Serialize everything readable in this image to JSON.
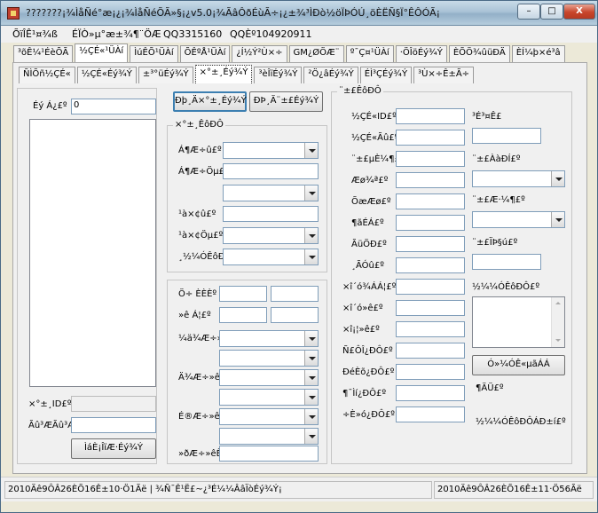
{
  "window": {
    "title": "???????¡¾ÌåÑé°æ¡¿¡¾ÌåÑéÕÃ»§¡¿v5.0¡¾ÃâÔðÉùÃ÷¡¿±¾³ÌÐò½öÏÞÓÚ¸öÈËÑ§Ï°ÊÔÓÃ¡",
    "minimize_label": "–",
    "maximize_label": "□",
    "close_label": "X"
  },
  "menu": {
    "items": [
      "ÕïÎÊ¹¤¾ß",
      "ÉÏÒ»µ°æ±¾¶¨ÖÆ",
      "QQ3315160",
      "QQÈº104920911"
    ]
  },
  "tabs_row1": [
    "³õÊ¼¹ÉèÕÃ",
    "½ÇÉ«¹ÜÀí",
    "ÌúÊÕ¹ÜÀí",
    "ÕÊºÅ¹ÜÀí",
    "¿Í½Ý²Ù×÷",
    "GM¿ØÖÆ¨",
    "º¯Ç¤¹ÜÀí",
    "·ÖÎöÉý¾Ý",
    "ÈÕÖ¾ûüÐÄ",
    "ÈÍ¼þ×é³â"
  ],
  "tabs_row2": [
    "ÑÌÕñ½ÇÉ«",
    "½ÇÉ«Éý¾Ý",
    "±³°üÉý¾Ý",
    "×°±¸Éý¾Ý",
    "³èÎïÉý¾Ý",
    "²Ö¿âÉý¾Ý",
    "ÉÌ³ÇÉý¾Ý",
    "³Ù×÷Ê±Ã÷"
  ],
  "tabs_row2_active": 3,
  "left": {
    "count_label": "Éý Á¿£º",
    "count_value": "0",
    "id_label": "×°±¸ID£º",
    "name_label": "Ãû³ÆÃû³Æ£º",
    "search_button": "ÌáÈ¡ÎïÆ·Éý¾Ý"
  },
  "middle": {
    "read_button": "Ðþ¸Ä×°±¸Éý¾Ý",
    "update_button": "ÐÞ¸Ä¨±£Éý¾Ý",
    "group1_title": "×°±¸ÊôÐÔ",
    "attr_labels": [
      "Á¶Æ÷û£º",
      "Á¶Æ÷Öµ£",
      "",
      "¹à×¢û£º",
      "¹à×¢Öµ£º",
      "¸½¼ÓÊôÐÔ£"
    ],
    "group2_labels": [
      "Ö÷ ÈÈÈº",
      "»ê  Á¦£º",
      "¼ä¾Æ÷»êÊ",
      "",
      "Ä¾Æ÷»êÊ",
      "",
      "É®Æ÷»êÊ",
      "",
      "»ðÆ÷»êÊ"
    ]
  },
  "right": {
    "group_title": "¨±£ÊôÐÔ",
    "left_labels": [
      "½ÇÉ«ID£º",
      "½ÇÉ«Ãû£º",
      "¨±£µÈ¼¶£º",
      "Æø¾ª£º",
      "ÕæÆø£º",
      "¶ãÉÁ£º",
      "ÃüÖÐ£º",
      "¸ÃÓû£º",
      "×î´ó¾ÁÁ¦£º",
      "×î´ó»ê£º",
      "×î¡¦»ê£º",
      "Ñ£ÔÎ¿ÐÔ£º",
      "ÐéÈõ¿ÐÔ£º",
      "¶¯Ìí¿ÐÔ£º",
      "÷È»ó¿ÐÔ£º"
    ],
    "right_labels": [
      "³É³¤Ê£",
      "¨±£ÀàÐÍ£º",
      "¨±£Æ·¼¶£º",
      "¨±£ÏÞ§ú£º",
      "½¼¼ÓÊôÐÔ£º"
    ],
    "apply_button": "Ó»¼ÓÊ«µãÁÁ",
    "extra_label": "¶ÄÜ£º",
    "extra_attr_label": "½¼¼ÓÊôÐÔÁÐ±í£º"
  },
  "status": {
    "left_text": "2010Äê9ÔÂ26ÈÕ16Ê±10·Ö1Ãë | ¾Ñ¯Ê¹Ë£~¿³É¼¼ÂâÏòÉý¾Ý¡",
    "right_text": "2010Äê9ÔÂ26ÈÕ16Ê±11·Ö56Ãë"
  }
}
